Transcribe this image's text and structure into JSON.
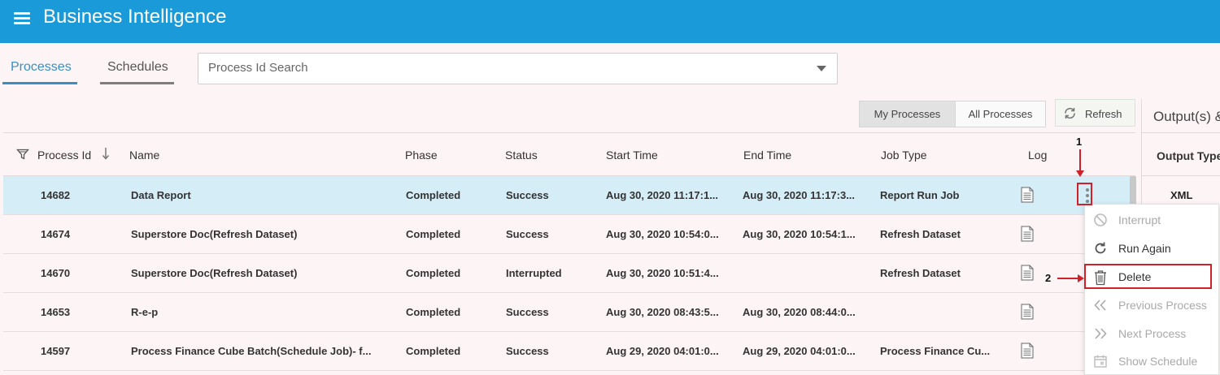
{
  "app": {
    "title": "Business Intelligence"
  },
  "tabs": [
    {
      "label": "Processes",
      "active": true
    },
    {
      "label": "Schedules",
      "active": false
    }
  ],
  "search": {
    "placeholder": "Process Id Search"
  },
  "filters": {
    "my_processes": "My Processes",
    "all_processes": "All Processes",
    "refresh": "Refresh"
  },
  "table": {
    "columns": [
      "Process Id",
      "Name",
      "Phase",
      "Status",
      "Start Time",
      "End Time",
      "Job Type",
      "Log"
    ],
    "sort_icon": "arrow-down-icon",
    "rows": [
      {
        "id": "14682",
        "name": "Data Report",
        "phase": "Completed",
        "status": "Success",
        "start": "Aug 30, 2020 11:17:1...",
        "end": "Aug 30, 2020 11:17:3...",
        "job_type": "Report Run Job",
        "selected": true
      },
      {
        "id": "14674",
        "name": "Superstore Doc(Refresh Dataset)",
        "phase": "Completed",
        "status": "Success",
        "start": "Aug 30, 2020 10:54:0...",
        "end": "Aug 30, 2020 10:54:1...",
        "job_type": "Refresh Dataset",
        "selected": false
      },
      {
        "id": "14670",
        "name": "Superstore Doc(Refresh Dataset)",
        "phase": "Completed",
        "status": "Interrupted",
        "start": "Aug 30, 2020 10:51:4...",
        "end": "",
        "job_type": "Refresh Dataset",
        "selected": false
      },
      {
        "id": "14653",
        "name": "R-e-p",
        "phase": "Completed",
        "status": "Success",
        "start": "Aug 30, 2020 08:43:5...",
        "end": "Aug 30, 2020 08:44:0...",
        "job_type": "",
        "selected": false
      },
      {
        "id": "14597",
        "name": "Process Finance Cube Batch(Schedule Job)- f...",
        "phase": "Completed",
        "status": "Success",
        "start": "Aug 29, 2020 04:01:0...",
        "end": "Aug 29, 2020 04:01:0...",
        "job_type": "Process Finance Cu...",
        "selected": false
      }
    ]
  },
  "output_panel": {
    "title": "Output(s) &",
    "column": "Output Type",
    "value": "XML"
  },
  "context_menu": {
    "items": [
      {
        "label": "Interrupt",
        "icon": "block-icon",
        "enabled": false
      },
      {
        "label": "Run Again",
        "icon": "rerun-icon",
        "enabled": true
      },
      {
        "label": "Delete",
        "icon": "trash-icon",
        "enabled": true
      },
      {
        "label": "Previous Process",
        "icon": "double-chevron-left-icon",
        "enabled": false
      },
      {
        "label": "Next Process",
        "icon": "double-chevron-right-icon",
        "enabled": false
      },
      {
        "label": "Show Schedule",
        "icon": "calendar-icon",
        "enabled": false
      }
    ]
  },
  "annotations": {
    "step1": "1",
    "step2": "2"
  },
  "colors": {
    "header": "#1a9ad9",
    "accent": "#3a8ec7",
    "selected_row": "#d4edf7",
    "annotation": "#d0212a"
  }
}
